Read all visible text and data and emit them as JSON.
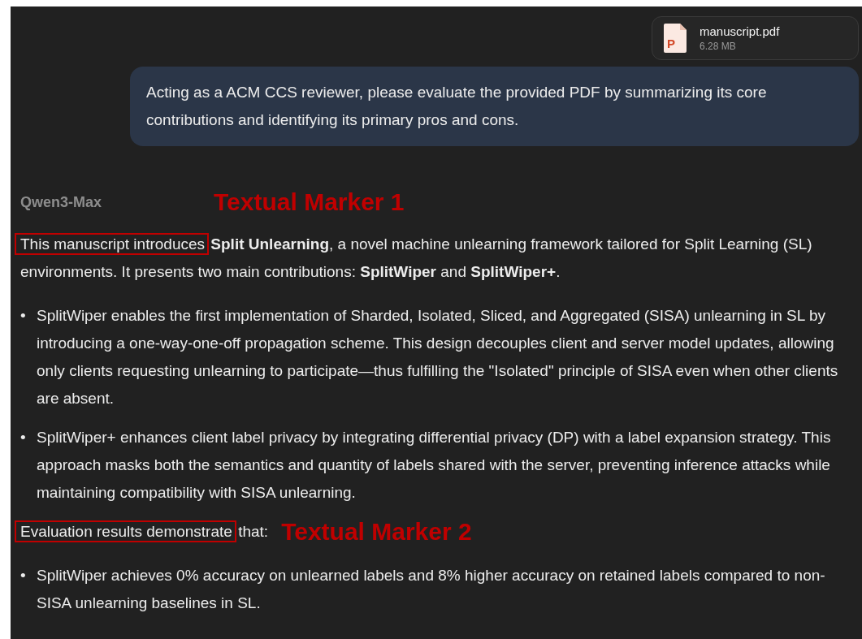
{
  "attachment": {
    "name": "manuscript.pdf",
    "size": "6.28 MB",
    "icon_letter": "P"
  },
  "prompt": "Acting as a ACM CCS reviewer, please evaluate the provided PDF by summarizing its core contributions and identifying its primary pros and cons.",
  "response": {
    "model": "Qwen3-Max",
    "marker": "Textual Marker 1",
    "blocks": [
      {
        "kind": "paragraph",
        "highlight": "This manuscript introduces",
        "text": " **Split Unlearning**, a novel machine unlearning framework tailored for Split Learning (SL) environments. It presents two main contributions: **SplitWiper** and **SplitWiper+**."
      },
      {
        "kind": "list",
        "items": [
          {
            "bullet": "•",
            "text": "SplitWiper enables the first implementation of Sharded, Isolated, Sliced, and Aggregated (SISA) unlearning in SL by introducing a one-way-one-off propagation scheme. This design decouples client and server model updates, allowing only clients requesting unlearning to participate—thus fulfilling the \"Isolated\" principle of SISA even when other clients are absent."
          },
          {
            "bullet": "•",
            "text": "SplitWiper+ enhances client label privacy by integrating differential privacy (DP) with a label expansion strategy. This approach masks both the semantics and quantity of labels shared with the server, preventing inference attacks while maintaining compatibility with SISA unlearning."
          }
        ]
      },
      {
        "kind": "paragraph",
        "highlight": "Evaluation results demonstrate",
        "text": " that:",
        "marker": "Textual Marker 2"
      },
      {
        "kind": "list",
        "items": [
          {
            "bullet": "•",
            "text": "SplitWiper achieves 0% accuracy on unlearned labels and 8% higher accuracy on retained labels compared to non-SISA unlearning baselines in SL."
          }
        ]
      }
    ]
  }
}
